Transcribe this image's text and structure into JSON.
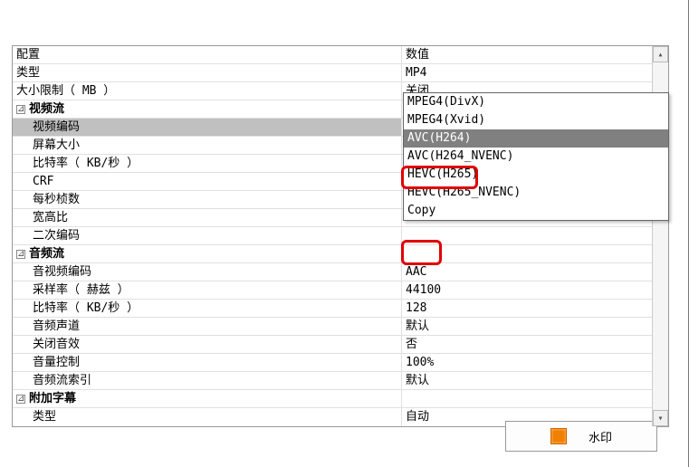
{
  "headers": {
    "left": "配置",
    "right": "数值"
  },
  "rows": [
    {
      "label": "类型",
      "value": "MP4",
      "indent": 0
    },
    {
      "label": "大小限制（ MB ）",
      "value": "关闭",
      "indent": 0
    },
    {
      "label": "视频流",
      "value": "",
      "indent": 0,
      "section": true
    },
    {
      "label": "视频编码",
      "value": "MPEG4(DivX)",
      "indent": 1,
      "selected": true,
      "dropdown": true
    },
    {
      "label": "屏幕大小",
      "value": "",
      "indent": 1
    },
    {
      "label": "比特率（ KB/秒 ）",
      "value": "",
      "indent": 1
    },
    {
      "label": "CRF",
      "value": "",
      "indent": 1
    },
    {
      "label": "每秒桢数",
      "value": "",
      "indent": 1
    },
    {
      "label": "宽高比",
      "value": "",
      "indent": 1
    },
    {
      "label": "二次编码",
      "value": "",
      "indent": 1
    },
    {
      "label": "音频流",
      "value": "",
      "indent": 0,
      "section": true
    },
    {
      "label": "音视频编码",
      "value": "AAC",
      "indent": 1
    },
    {
      "label": "采样率（ 赫兹 ）",
      "value": "44100",
      "indent": 1
    },
    {
      "label": "比特率（ KB/秒 ）",
      "value": "128",
      "indent": 1
    },
    {
      "label": "音频声道",
      "value": "默认",
      "indent": 1
    },
    {
      "label": "关闭音效",
      "value": "否",
      "indent": 1
    },
    {
      "label": "音量控制",
      "value": "100%",
      "indent": 1
    },
    {
      "label": "音频流索引",
      "value": "默认",
      "indent": 1
    },
    {
      "label": "附加字幕",
      "value": "",
      "indent": 0,
      "section": true
    },
    {
      "label": "类型",
      "value": "自动",
      "indent": 1
    }
  ],
  "dropdown": {
    "items": [
      "MPEG4(DivX)",
      "MPEG4(Xvid)",
      "AVC(H264)",
      "AVC(H264_NVENC)",
      "HEVC(H265)",
      "HEVC(H265_NVENC)",
      "Copy"
    ],
    "highlighted_index": 2
  },
  "footer": {
    "button_label": "水印"
  },
  "expander_glyph": "⊿",
  "dropdown_arrow": "▾",
  "scroll_up": "▴",
  "scroll_down": "▾"
}
